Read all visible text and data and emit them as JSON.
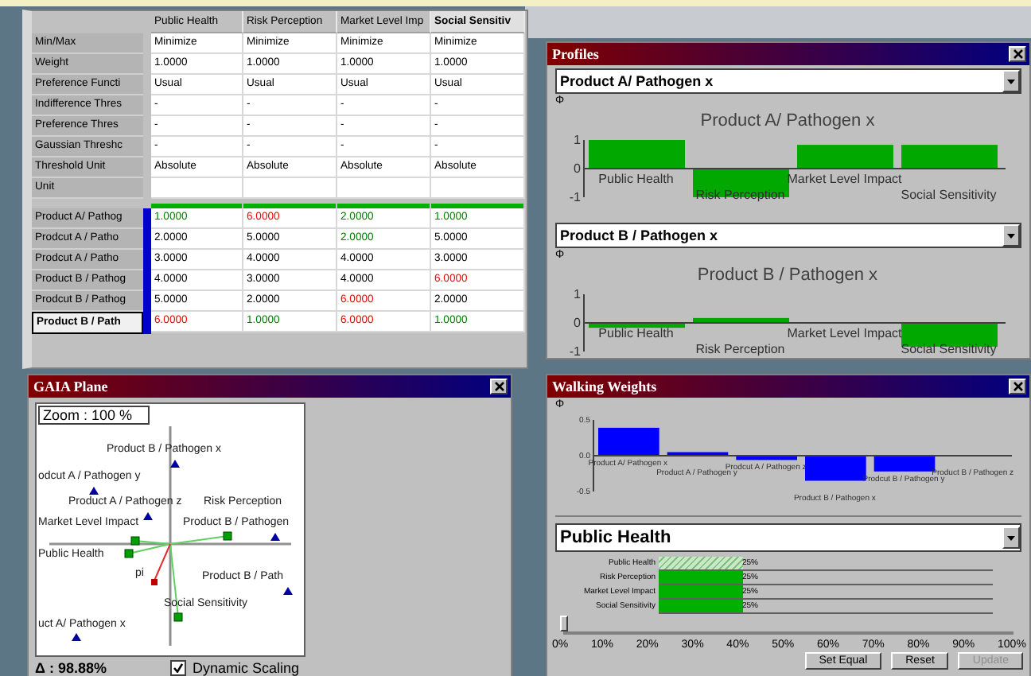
{
  "table": {
    "columns": [
      {
        "label": "Public Health",
        "selected": false
      },
      {
        "label": "Risk Perception",
        "selected": false
      },
      {
        "label": "Market Level Imp",
        "selected": false
      },
      {
        "label": "Social Sensitiv",
        "selected": true
      }
    ],
    "parameters": [
      {
        "label": "Min/Max",
        "values": [
          "Minimize",
          "Minimize",
          "Minimize",
          "Minimize"
        ]
      },
      {
        "label": "Weight",
        "values": [
          "1.0000",
          "1.0000",
          "1.0000",
          "1.0000"
        ]
      },
      {
        "label": "Preference Functi",
        "values": [
          "Usual",
          "Usual",
          "Usual",
          "Usual"
        ]
      },
      {
        "label": "Indifference Thres",
        "values": [
          "-",
          "-",
          "-",
          "-"
        ]
      },
      {
        "label": "Preference Thres",
        "values": [
          "-",
          "-",
          "-",
          "-"
        ]
      },
      {
        "label": "Gaussian Threshc",
        "values": [
          "-",
          "-",
          "-",
          "-"
        ]
      },
      {
        "label": "Threshold Unit",
        "values": [
          "Absolute",
          "Absolute",
          "Absolute",
          "Absolute"
        ]
      },
      {
        "label": "Unit"
      }
    ],
    "alternatives": [
      {
        "label": "Product A/ Pathog",
        "selected": false,
        "cells": [
          {
            "value": "1.0000",
            "color": "#008000"
          },
          {
            "value": "6.0000",
            "color": "#ff0000"
          },
          {
            "value": "2.0000",
            "color": "#008000"
          },
          {
            "value": "1.0000",
            "color": "#008000"
          }
        ]
      },
      {
        "label": "Prodcut A / Patho",
        "selected": false,
        "cells": [
          {
            "value": "2.0000",
            "color": "#000000"
          },
          {
            "value": "5.0000",
            "color": "#000000"
          },
          {
            "value": "2.0000",
            "color": "#008000"
          },
          {
            "value": "5.0000",
            "color": "#000000"
          }
        ]
      },
      {
        "label": "Prodcut A / Patho",
        "selected": false,
        "cells": [
          {
            "value": "3.0000",
            "color": "#000000"
          },
          {
            "value": "4.0000",
            "color": "#000000"
          },
          {
            "value": "4.0000",
            "color": "#000000"
          },
          {
            "value": "3.0000",
            "color": "#000000"
          }
        ]
      },
      {
        "label": "Product B / Pathog",
        "selected": false,
        "cells": [
          {
            "value": "4.0000",
            "color": "#000000"
          },
          {
            "value": "3.0000",
            "color": "#000000"
          },
          {
            "value": "4.0000",
            "color": "#000000"
          },
          {
            "value": "6.0000",
            "color": "#ff0000"
          }
        ]
      },
      {
        "label": "Prodcut B / Pathog",
        "selected": false,
        "cells": [
          {
            "value": "5.0000",
            "color": "#000000"
          },
          {
            "value": "2.0000",
            "color": "#000000"
          },
          {
            "value": "6.0000",
            "color": "#ff0000"
          },
          {
            "value": "2.0000",
            "color": "#000000"
          }
        ]
      },
      {
        "label": "Product B / Path",
        "selected": true,
        "cells": [
          {
            "value": "6.0000",
            "color": "#ff0000"
          },
          {
            "value": "1.0000",
            "color": "#008000"
          },
          {
            "value": "6.0000",
            "color": "#ff0000"
          },
          {
            "value": "1.0000",
            "color": "#008000"
          }
        ]
      }
    ]
  },
  "profiles": {
    "title": "Profiles",
    "panels": [
      {
        "selected_option": "Product A/ Pathogen x",
        "chart_data": {
          "type": "bar",
          "title": "Product A/ Pathogen x",
          "categories": [
            "Public Health",
            "Risk Perception",
            "Market Level Impact",
            "Social Sensitivity"
          ],
          "series": [
            {
              "name": "Φ",
              "color": "#00a800",
              "values": [
                1.0,
                -1.0,
                0.83,
                0.83
              ]
            }
          ],
          "ylim": [
            -1,
            1
          ],
          "yticks": [
            -1,
            0,
            1
          ]
        }
      },
      {
        "selected_option": "Product B / Pathogen x",
        "chart_data": {
          "type": "bar",
          "title": "Product B / Pathogen x",
          "categories": [
            "Public Health",
            "Risk Perception",
            "Market Level Impact",
            "Social Sensitivity"
          ],
          "series": [
            {
              "name": "Φ",
              "color": "#00a800",
              "values": [
                -0.17,
                0.17,
                0,
                -0.83
              ]
            }
          ],
          "ylim": [
            -1,
            1
          ],
          "yticks": [
            -1,
            0,
            1
          ]
        }
      }
    ]
  },
  "gaia": {
    "title": "GAIA Plane",
    "zoom": "Zoom : 100 %",
    "alternatives": [
      {
        "label": "Product B / Pathogen x"
      },
      {
        "label": "odcut A / Pathogen y"
      },
      {
        "label": "Product A / Pathogen z"
      },
      {
        "label": "Product B / Pathogen"
      },
      {
        "label": "Product B / Path"
      },
      {
        "label": "uct A/ Pathogen x"
      }
    ],
    "criteria": [
      {
        "label": "Risk Perception"
      },
      {
        "label": "Market Level Impact"
      },
      {
        "label": "Public Health"
      },
      {
        "label": "Social Sensitivity"
      }
    ],
    "decision_axis": "pi",
    "delta": "Δ : 98.88%",
    "dynamic_scaling": {
      "label": "Dynamic Scaling",
      "checked": true
    }
  },
  "walking_weights": {
    "title": "Walking Weights",
    "chart_data": {
      "type": "bar",
      "categories": [
        "Product A/ Pathogen x",
        "Product A / Pathogen y",
        "Prodcut A / Pathogen z",
        "Product B / Pathogen x",
        "Prodcut B / Pathogen y",
        "Product B / Pathogen z"
      ],
      "series": [
        {
          "name": "Φ",
          "color": "#0000ff",
          "values": [
            0.39,
            0.05,
            -0.06,
            -0.35,
            -0.22,
            0
          ]
        }
      ],
      "ylim": [
        -0.5,
        0.5
      ],
      "yticks": [
        {
          "value": -0.5,
          "label": "-0.5"
        },
        {
          "value": 0,
          "label": "0.0"
        },
        {
          "value": 0.5,
          "label": "0.5"
        }
      ]
    },
    "criterion": "Public Health",
    "weights": [
      {
        "label": "Public Health",
        "level": 0.25,
        "reading": "25%",
        "selected": true
      },
      {
        "label": "Risk Perception",
        "level": 0.25,
        "reading": "25%",
        "selected": false
      },
      {
        "label": "Market Level Impact",
        "level": 0.25,
        "reading": "25%",
        "selected": false
      },
      {
        "label": "Social Sensitivity",
        "level": 0.25,
        "reading": "25%",
        "selected": false
      }
    ],
    "slider": {
      "level": 0,
      "ticks": [
        "0%",
        "10%",
        "20%",
        "30%",
        "40%",
        "50%",
        "60%",
        "70%",
        "80%",
        "90%",
        "100%"
      ]
    },
    "buttons": [
      {
        "label": "Set Equal",
        "disabled": false
      },
      {
        "label": "Reset",
        "disabled": false
      },
      {
        "label": "Update",
        "disabled": true
      }
    ]
  }
}
